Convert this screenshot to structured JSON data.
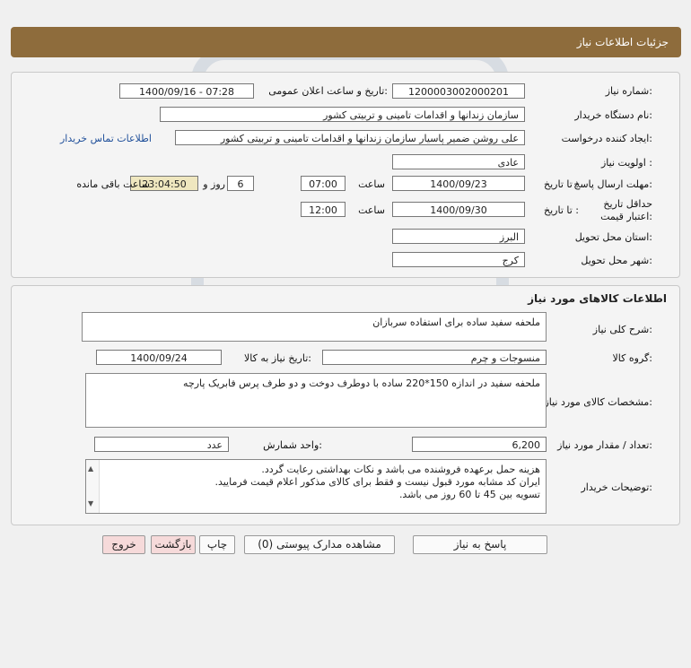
{
  "header": {
    "title": "جزئیات اطلاعات نیاز"
  },
  "need_info": {
    "need_number_label": "شماره نیاز:",
    "need_number": "1200003002000201",
    "announce_label": "تاریخ و ساعت اعلان عمومی:",
    "announce_value": "1400/09/16 - 07:28",
    "buyer_org_label": "نام دستگاه خریدار:",
    "buyer_org": "سازمان زندانها و اقدامات تامینی و تربیتی کشور",
    "creator_label": "ایجاد کننده درخواست:",
    "creator": "علی روشن ضمیر پاسیار سازمان زندانها و اقدامات تامینی و تربیتی کشور",
    "contact_link": "اطلاعات تماس خریدار",
    "priority_label": "اولویت نیاز :",
    "priority": "عادی",
    "deadline_label": "مهلت ارسال پاسخ:",
    "to_date_label": "تا تاریخ :",
    "deadline_date": "1400/09/23",
    "time_label": "ساعت",
    "deadline_time": "07:00",
    "days_value": "6",
    "days_label": "روز و",
    "remaining_time": "23:04:50",
    "remaining_label": "ساعت باقی مانده",
    "validity_label": "حداقل تاریخ اعتبار قیمت:",
    "validity_to_label": "تا تاریخ :",
    "validity_date": "1400/09/30",
    "validity_time_label": "ساعت",
    "validity_time": "12:00",
    "province_label": "استان محل تحویل:",
    "province": "البرز",
    "city_label": "شهر محل تحویل:",
    "city": "کرج"
  },
  "goods": {
    "section_title": "اطلاعات کالاهای مورد نیاز",
    "general_desc_label": "شرح کلی نیاز:",
    "general_desc": "ملحفه سفید ساده برای استفاده سربازان",
    "group_label": "گروه کالا:",
    "group": "منسوجات و چرم",
    "need_date_label": "تاریخ نیاز به کالا:",
    "need_date": "1400/09/24",
    "specs_label": "مشخصات کالای مورد نیاز:",
    "specs": "ملحفه سفید در اندازه 150*220 ساده با دوطرف دوخت و دو طرف پرس فابریک پارچه",
    "qty_label": "تعداد / مقدار مورد نیاز:",
    "qty": "6,200",
    "unit_label": "واحد شمارش:",
    "unit": "عدد",
    "buyer_notes_label": "توضیحات خریدار:",
    "buyer_notes": [
      "هزینه حمل برعهده فروشنده می باشد و نکات بهداشتی رعایت گردد.",
      "ایران کد مشابه مورد قبول نیست و فقط برای کالای مذکور اعلام قیمت فرمایید.",
      "تسویه بین 45 تا 60 روز می باشد."
    ]
  },
  "buttons": {
    "reply": "پاسخ به نیاز",
    "attachments": "مشاهده مدارک پیوستی (0)",
    "print": "چاپ",
    "back": "بازگشت",
    "exit": "خروج"
  },
  "colors": {
    "header_bg": "#8e6c3c",
    "link": "#1f4f9a",
    "remaining_bg": "#efe7bf",
    "exit_bg": "#f6dada"
  }
}
